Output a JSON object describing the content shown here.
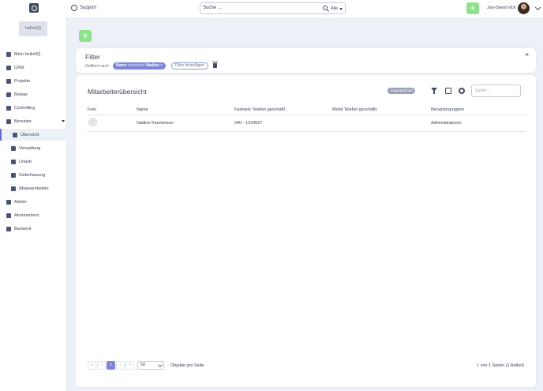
{
  "topbar": {
    "support_label": "Support",
    "search_placeholder": "Suche ...",
    "search_scope": "Alle",
    "add_label": "+",
    "user_name": "Jan-David Vick"
  },
  "sidebar": {
    "company": "helloHQ",
    "items": [
      {
        "label": "Mein helloHQ",
        "icon": "dashboard-icon"
      },
      {
        "label": "CRM",
        "icon": "crm-icon"
      },
      {
        "label": "Projekte",
        "icon": "projects-icon"
      },
      {
        "label": "Belege",
        "icon": "documents-icon"
      },
      {
        "label": "Controlling",
        "icon": "controlling-icon"
      },
      {
        "label": "Benutzer",
        "icon": "users-icon"
      },
      {
        "label": "Übersicht",
        "icon": "overview-icon"
      },
      {
        "label": "Verwaltung",
        "icon": "management-icon"
      },
      {
        "label": "Urlaub",
        "icon": "vacation-icon"
      },
      {
        "label": "Zeiterfassung",
        "icon": "time-tracking-icon"
      },
      {
        "label": "Abwesenheiten",
        "icon": "absence-icon"
      },
      {
        "label": "Admin",
        "icon": "admin-icon"
      },
      {
        "label": "Abonnement",
        "icon": "subscription-icon"
      },
      {
        "label": "Backend",
        "icon": "backend-icon"
      }
    ]
  },
  "main": {
    "add_label": "+"
  },
  "filter": {
    "title": "Filter",
    "filtered_by": "Gefiltert nach",
    "chip_field": "Name",
    "chip_operator": "beinhaltet",
    "chip_value": "Nadine",
    "chip_remove": "×",
    "add_filter": "Filter hinzufügen",
    "close": "×"
  },
  "table": {
    "title": "Mitarbeiterübersicht",
    "unsaved_label": "Ungespeichert",
    "search_placeholder": "Suche ...",
    "columns": [
      "Foto",
      "Name",
      "Festnetz Telefon geschäftl.",
      "Mobil Telefon geschäftl.",
      "Benutzergruppen"
    ],
    "rows": [
      {
        "name": "Nadine Karstensen",
        "phone": "040 - 1234567",
        "mobile": "",
        "groups": "Administratoren"
      }
    ]
  },
  "pagination": {
    "first": "«",
    "prev": "‹",
    "current_page": "1",
    "next": "›",
    "last": "»",
    "per_page": "50",
    "per_page_label": "Objekte pro Seite",
    "info": "1 von 1 Seiten (1 Artikel)"
  },
  "colors": {
    "accent": "#7c86d8",
    "add_button": "#8fe08f",
    "background": "#eef0f8"
  }
}
